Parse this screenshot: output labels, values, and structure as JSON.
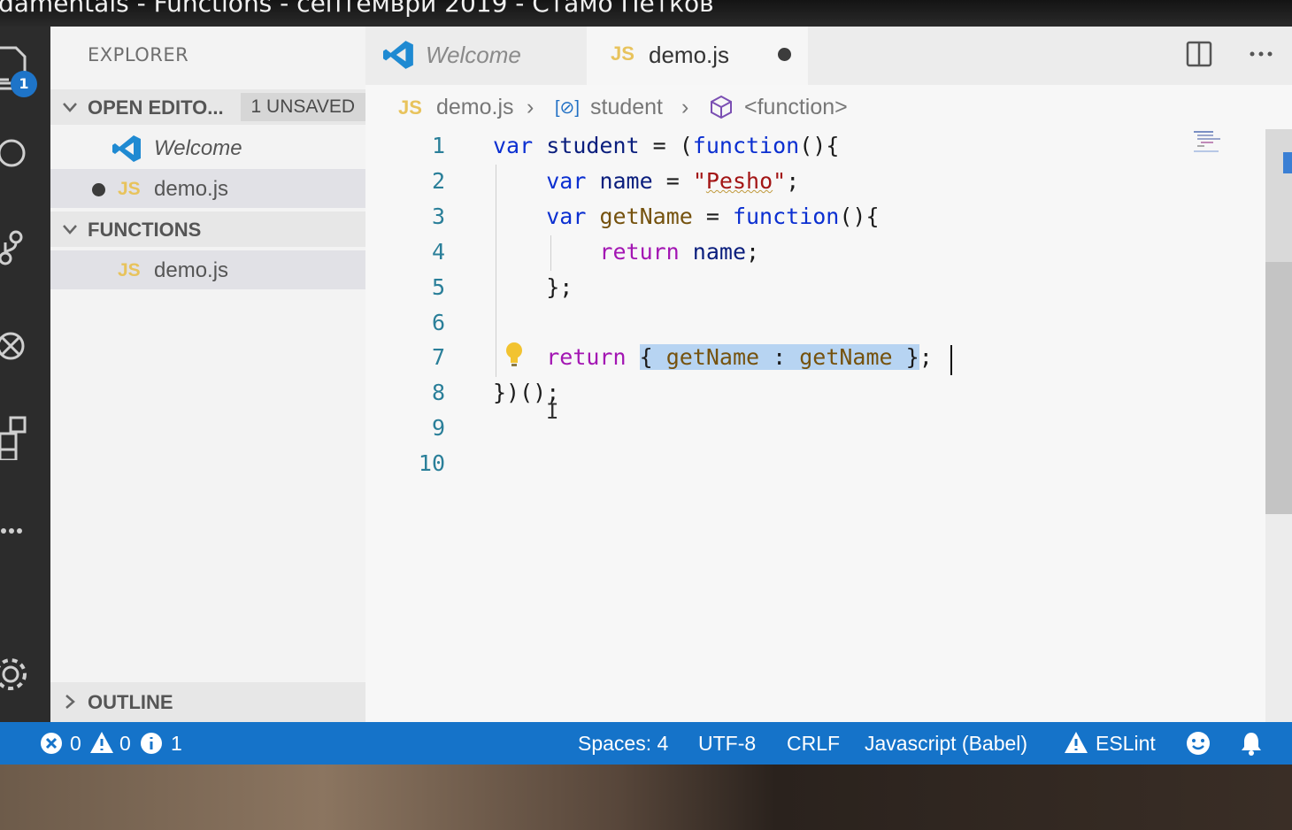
{
  "video_title": "damentals - Functions - септември 2019 - Стамо Петков",
  "activity_bar": {
    "explorer_badge": "1"
  },
  "sidebar": {
    "title": "EXPLORER",
    "open_editors": {
      "label": "OPEN EDITO...",
      "badge": "1 UNSAVED",
      "items": [
        {
          "label": "Welcome"
        },
        {
          "label": "demo.js",
          "icon": "JS"
        }
      ]
    },
    "functions": {
      "label": "FUNCTIONS",
      "items": [
        {
          "label": "demo.js",
          "icon": "JS"
        }
      ]
    },
    "outline": {
      "label": "OUTLINE"
    }
  },
  "tabs": [
    {
      "label": "Welcome"
    },
    {
      "label": "demo.js",
      "icon": "JS"
    }
  ],
  "breadcrumb": {
    "file": "demo.js",
    "file_icon": "JS",
    "symbol": "student",
    "symbol_icon": "[⊘]",
    "scope": "<function>"
  },
  "editor": {
    "line_numbers": [
      "1",
      "2",
      "3",
      "4",
      "5",
      "6",
      "7",
      "8",
      "9",
      "10"
    ],
    "lines": [
      "var student = (function(){",
      "    var name = \"Pesho\";",
      "    var getName = function(){",
      "        return name;",
      "    };",
      "",
      "    return { getName : getName };",
      "})();",
      "",
      ""
    ]
  },
  "statusbar": {
    "errors": "0",
    "warnings": "0",
    "info": "1",
    "spaces": "Spaces: 4",
    "encoding": "UTF-8",
    "eol": "CRLF",
    "language": "Javascript (Babel)",
    "eslint": "ESLint"
  },
  "colors": {
    "status_bar": "#1573c9",
    "sidebar": "#f3f3f3",
    "editor": "#f7f7f7",
    "keyword": "#0b2fd1",
    "string": "#a31515",
    "selection": "#b7d4f2"
  }
}
